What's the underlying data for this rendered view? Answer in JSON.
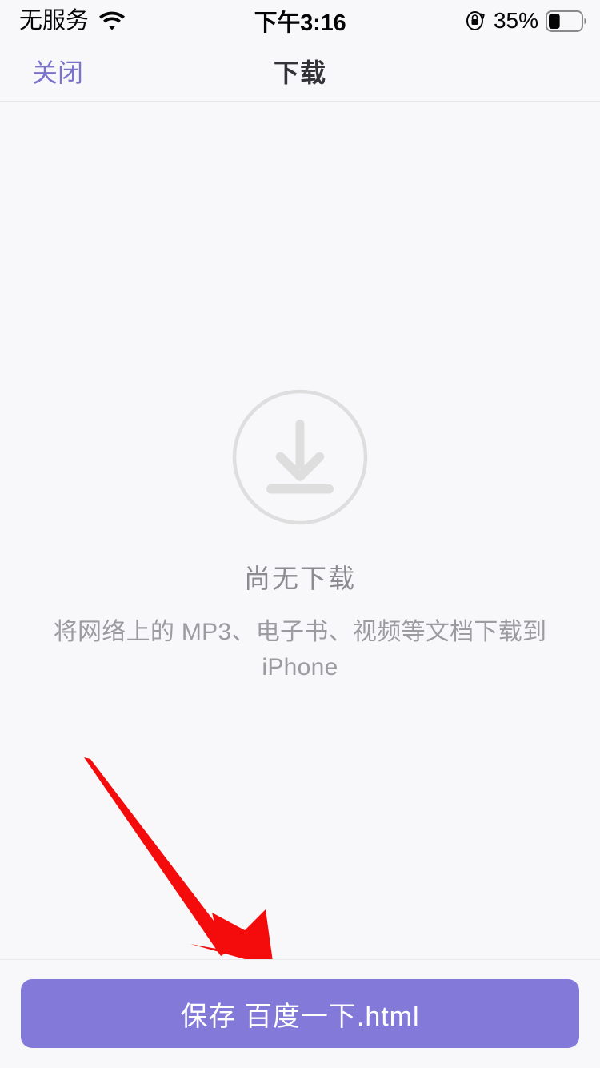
{
  "status_bar": {
    "carrier": "无服务",
    "wifi_icon": "wifi-icon",
    "time": "下午3:16",
    "rotation_lock_icon": "rotation-lock-icon",
    "battery_percent": "35%",
    "battery_level": 35,
    "battery_icon": "battery-icon",
    "text_color": "#050505"
  },
  "nav_bar": {
    "close_label": "关闭",
    "title": "下载",
    "close_color": "#7b73cc",
    "title_color": "#333338",
    "border_color": "#e6e6e9"
  },
  "empty_state": {
    "icon_name": "download-circle-arrow-icon",
    "icon_color": "#dedede",
    "title": "尚无下载",
    "subtitle": "将网络上的 MP3、电子书、视频等文档下载到 iPhone",
    "title_color": "#8b8b90",
    "subtitle_color": "#9b9ba0"
  },
  "annotation": {
    "arrow_name": "red-pointer-arrow",
    "color": "#f40c0c",
    "points_to": "save-button"
  },
  "bottom_bar": {
    "save_label": "保存 百度一下.html",
    "button_color": "#8279d8",
    "label_color": "#ffffff"
  },
  "theme": {
    "background": "#f8f8fa",
    "accent": "#8279d8"
  }
}
